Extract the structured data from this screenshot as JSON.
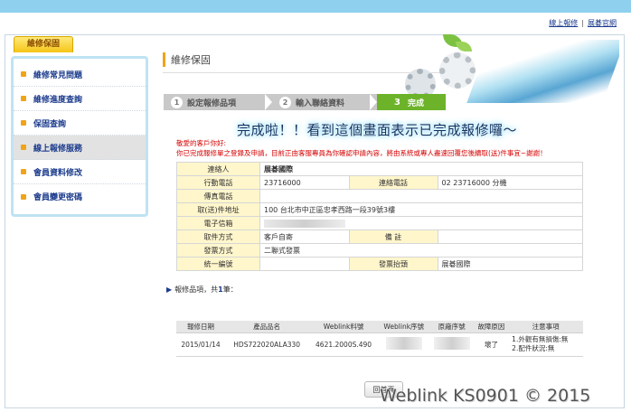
{
  "header": {
    "links": [
      "線上報修",
      "展碁官網"
    ]
  },
  "sidebar": {
    "tab_label": "維修保固",
    "items": [
      {
        "label": "維修常見問題"
      },
      {
        "label": "維修進度查詢"
      },
      {
        "label": "保固查詢"
      },
      {
        "label": "線上報修服務"
      },
      {
        "label": "會員資料修改"
      },
      {
        "label": "會員變更密碼"
      }
    ]
  },
  "main": {
    "title": "維修保固",
    "steps": [
      {
        "num": "1",
        "label": "設定報修品項"
      },
      {
        "num": "2",
        "label": "輸入聯絡資料"
      },
      {
        "num": "3",
        "label": "完成"
      }
    ],
    "annotation": "完成啦！！看到這個畫面表示已完成報修囉～",
    "notice_line1": "敬愛的客戶你好:",
    "notice_line2": "你已完成報修單之登錄及申請，目前正由客服專員為你確認申請內容，將由系統或專人盡速回覆您後續取(送)件事宜~謝謝！"
  },
  "contact": {
    "contact_person_label": "連絡人",
    "contact_person": "展碁國際",
    "mobile_label": "行動電話",
    "mobile": "23716000",
    "phone_label": "連絡電話",
    "phone": "02 23716000 分機",
    "fax_label": "傳真電話",
    "address_label": "取(送)件地址",
    "address": "100 台北市中正區忠孝西路一段39號3樓",
    "email_label": "電子信箱",
    "pickup_label": "取件方式",
    "pickup": "客戶自寄",
    "remark_label": "備 註",
    "invoice_label": "發票方式",
    "invoice": "二聯式發票",
    "tax_id_label": "統一編號",
    "invoice_title_label": "發票抬頭",
    "invoice_title": "展碁國際"
  },
  "items": {
    "heading_prefix": "報修品項，共",
    "count": "1",
    "heading_suffix": "筆：",
    "columns": [
      "報修日期",
      "產品品名",
      "Weblink料號",
      "Weblink序號",
      "原廠序號",
      "故障原因",
      "注意事項"
    ],
    "rows": [
      {
        "date": "2015/01/14",
        "product": "HDS722020ALA330",
        "part_no": "4621.2000S.490",
        "reason": "壞了",
        "note1": "1.外觀有無損傷:無",
        "note2": "2.配件狀況:無"
      }
    ]
  },
  "back_button": "回首頁",
  "watermark": "Weblink KS0901 © 2015"
}
